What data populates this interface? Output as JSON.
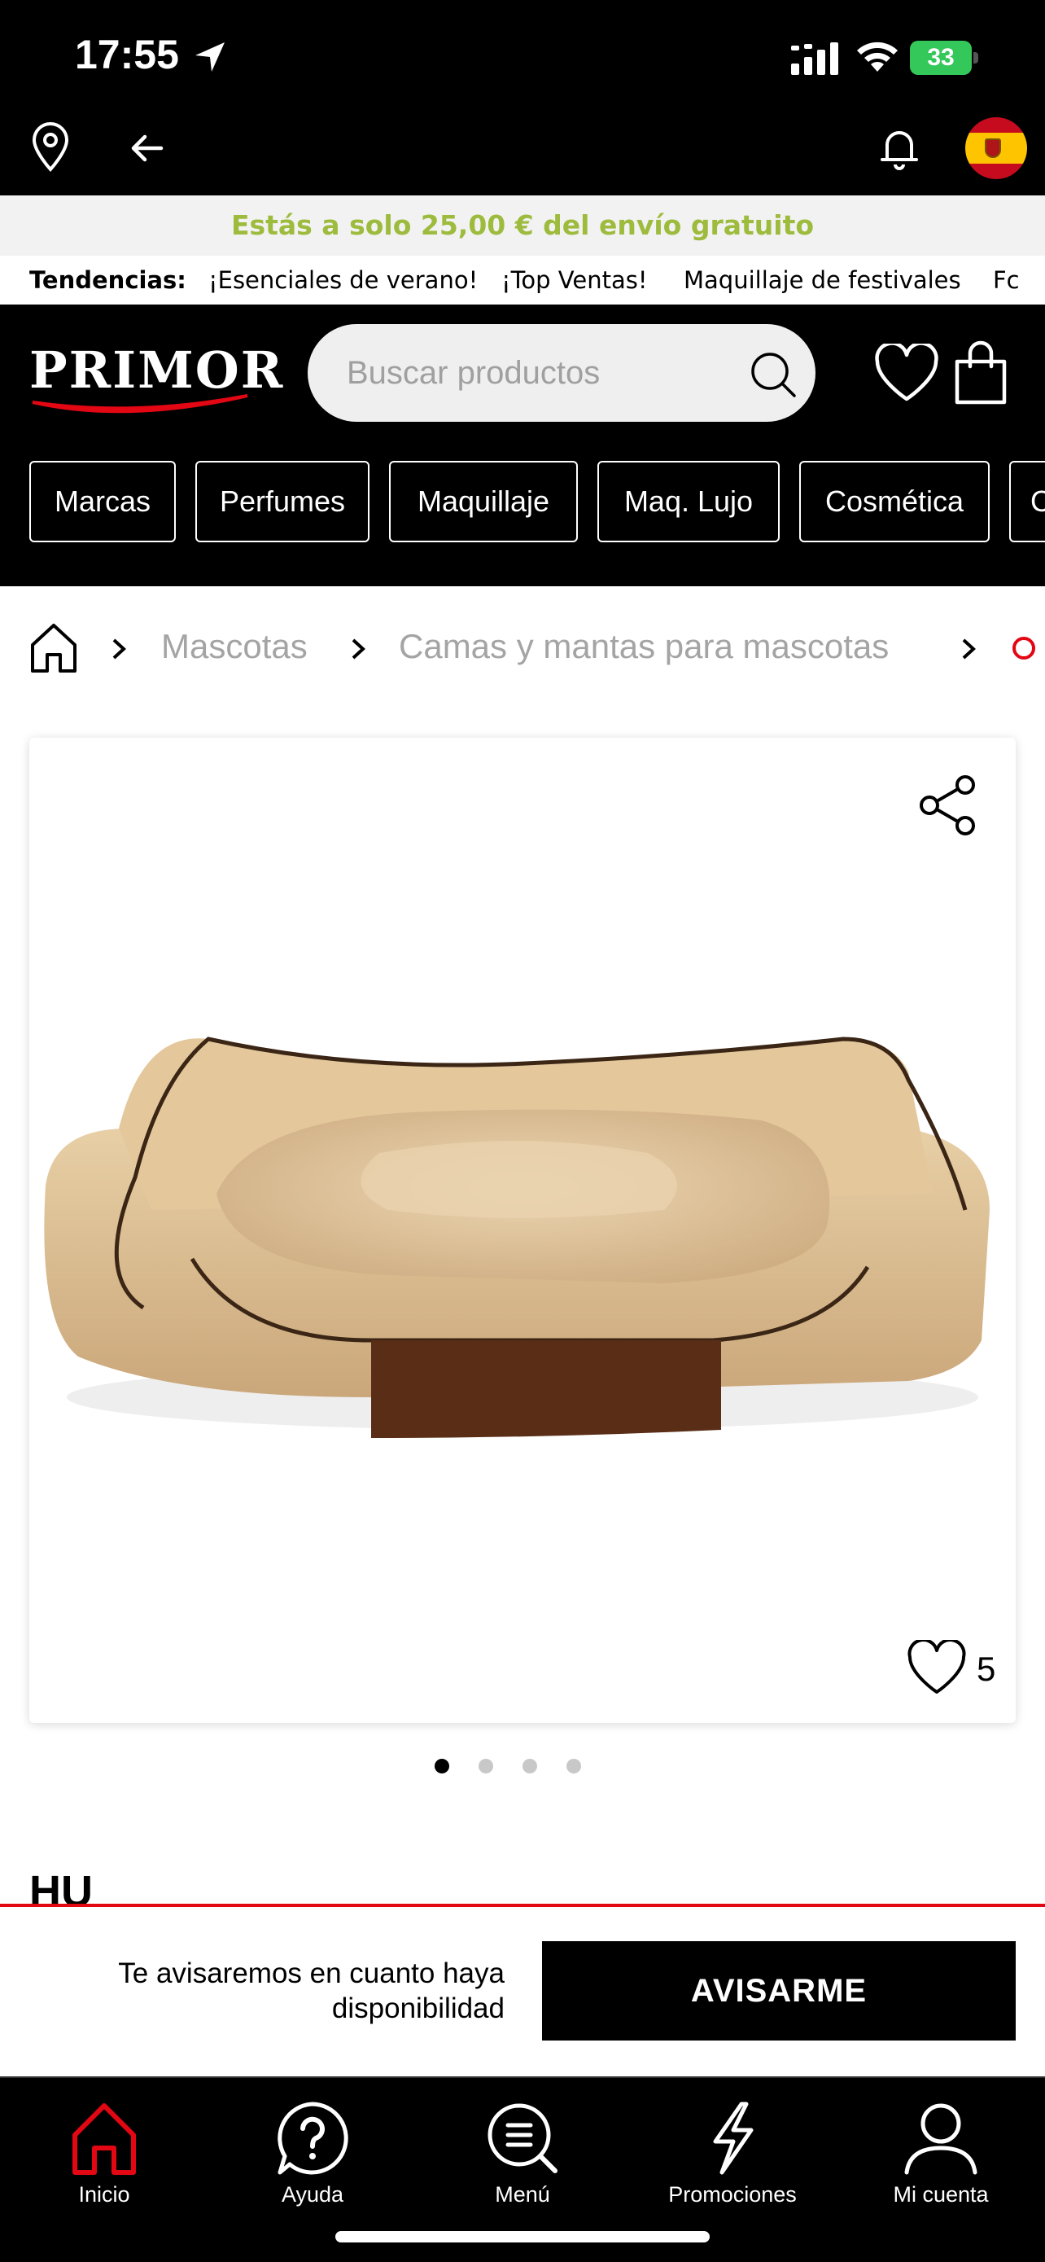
{
  "status_bar": {
    "time": "17:55",
    "battery": "33"
  },
  "shipping_banner": "Estás a solo 25,00 € del envío gratuito",
  "trends": {
    "title": "Tendencias:",
    "items": [
      "¡Esenciales de verano!",
      "¡Top Ventas!",
      "Maquillaje de festivales",
      "Fc"
    ]
  },
  "brand": {
    "logo": "PRIMOR"
  },
  "search": {
    "placeholder": "Buscar productos"
  },
  "categories": [
    "Marcas",
    "Perfumes",
    "Maquillaje",
    "Maq. Lujo",
    "Cosmética",
    "C"
  ],
  "breadcrumb": [
    "Mascotas",
    "Camas y mantas para mascotas"
  ],
  "product": {
    "favorites_count": "5",
    "title": "HU",
    "image_count": 4,
    "active_image": 0
  },
  "notify": {
    "text": "Te avisaremos en cuanto haya disponibilidad",
    "button": "AVISARME"
  },
  "tabs": [
    "Inicio",
    "Ayuda",
    "Menú",
    "Promociones",
    "Mi cuenta"
  ],
  "colors": {
    "accent_red": "#e30613",
    "banner_green": "#9dbb3c",
    "battery_green": "#34c759"
  }
}
